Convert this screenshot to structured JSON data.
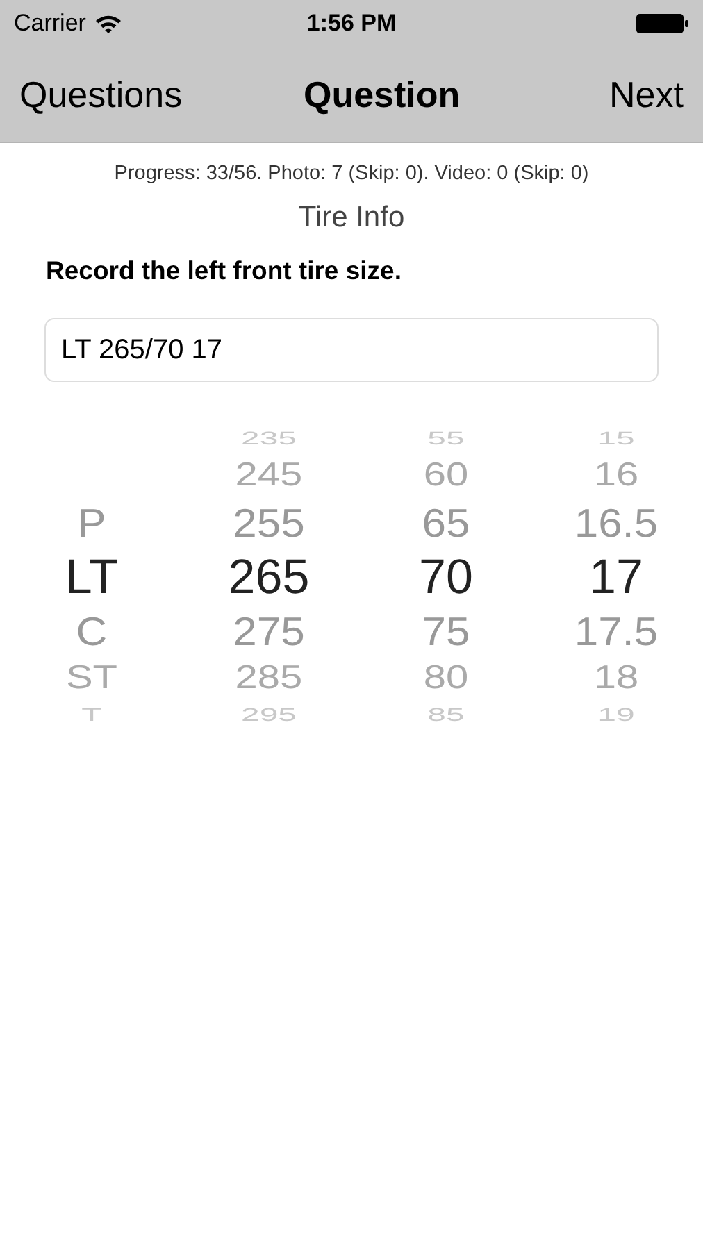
{
  "status_bar": {
    "carrier": "Carrier",
    "time": "1:56 PM"
  },
  "nav_bar": {
    "back": "Questions",
    "title": "Question",
    "next": "Next"
  },
  "progress": "Progress: 33/56. Photo: 7 (Skip: 0). Video: 0 (Skip: 0)",
  "section": "Tire Info",
  "question": "Record the left front tire size.",
  "answer": {
    "value": "LT 265/70 17"
  },
  "picker": {
    "columns": [
      {
        "items": [
          {
            "label": "P",
            "selected": false
          },
          {
            "label": "LT",
            "selected": true
          },
          {
            "label": "C",
            "selected": false
          },
          {
            "label": "ST",
            "selected": false
          },
          {
            "label": "T",
            "selected": false
          }
        ]
      },
      {
        "items": [
          {
            "label": "235",
            "selected": false
          },
          {
            "label": "245",
            "selected": false
          },
          {
            "label": "255",
            "selected": false
          },
          {
            "label": "265",
            "selected": true
          },
          {
            "label": "275",
            "selected": false
          },
          {
            "label": "285",
            "selected": false
          },
          {
            "label": "295",
            "selected": false
          }
        ]
      },
      {
        "items": [
          {
            "label": "55",
            "selected": false
          },
          {
            "label": "60",
            "selected": false
          },
          {
            "label": "65",
            "selected": false
          },
          {
            "label": "70",
            "selected": true
          },
          {
            "label": "75",
            "selected": false
          },
          {
            "label": "80",
            "selected": false
          },
          {
            "label": "85",
            "selected": false
          }
        ]
      },
      {
        "items": [
          {
            "label": "15",
            "selected": false
          },
          {
            "label": "16",
            "selected": false
          },
          {
            "label": "16.5",
            "selected": false
          },
          {
            "label": "17",
            "selected": true
          },
          {
            "label": "17.5",
            "selected": false
          },
          {
            "label": "18",
            "selected": false
          },
          {
            "label": "19",
            "selected": false
          }
        ]
      }
    ]
  }
}
